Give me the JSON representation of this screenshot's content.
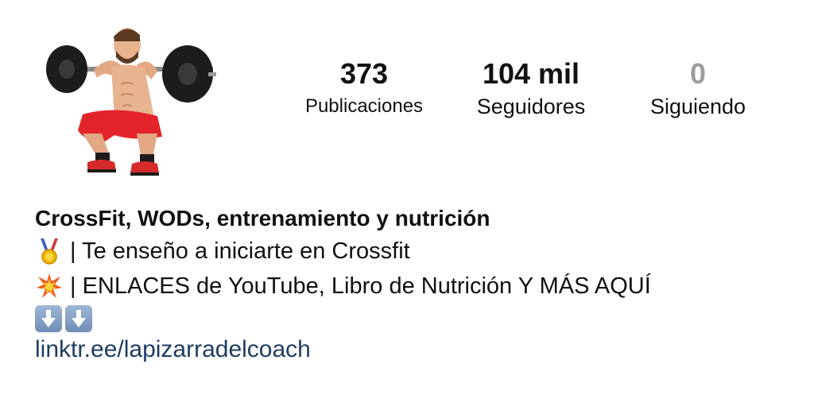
{
  "profile": {
    "avatar_icon": "weightlifter-squat-icon",
    "stats": {
      "posts": {
        "value": "373",
        "label": "Publicaciones"
      },
      "followers": {
        "value": "104 mil",
        "label": "Seguidores"
      },
      "following": {
        "value": "0",
        "label": "Siguiendo"
      }
    },
    "bio": {
      "name": "CrossFit, WODs, entrenamiento y nutrición",
      "line1": "| Te enseño a iniciarte en Crossfit",
      "line1_icon": "medal-icon",
      "line2": "| ENLACES de YouTube, Libro de Nutrición Y MÁS AQUÍ",
      "line2_icon": "collision-icon",
      "arrows_icon": "down-arrow-icon",
      "link": "linktr.ee/lapizarradelcoach"
    }
  },
  "colors": {
    "text": "#111111",
    "muted": "#9e9e9e",
    "link": "#1f3d63",
    "shorts_red": "#e3242b"
  }
}
